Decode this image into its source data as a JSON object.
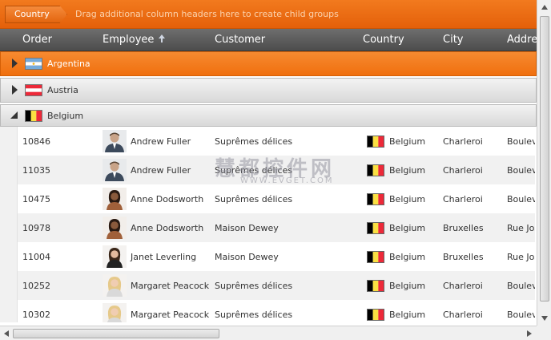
{
  "group_panel": {
    "chip_label": "Country",
    "hint": "Drag additional column headers here to create child groups"
  },
  "columns": [
    "Order",
    "Employee",
    "Customer",
    "Country",
    "City",
    "Addre"
  ],
  "groups": [
    {
      "label": "Argentina",
      "expanded": false,
      "active": true
    },
    {
      "label": "Austria",
      "expanded": false,
      "active": false
    },
    {
      "label": "Belgium",
      "expanded": true,
      "active": false
    }
  ],
  "rows": [
    {
      "order": "10846",
      "employee": "Andrew Fuller",
      "customer": "Suprêmes délices",
      "country": "Belgium",
      "city": "Charleroi",
      "address": "Boulev"
    },
    {
      "order": "11035",
      "employee": "Andrew Fuller",
      "customer": "Suprêmes délices",
      "country": "Belgium",
      "city": "Charleroi",
      "address": "Boulev"
    },
    {
      "order": "10475",
      "employee": "Anne Dodsworth",
      "customer": "Suprêmes délices",
      "country": "Belgium",
      "city": "Charleroi",
      "address": "Boulev"
    },
    {
      "order": "10978",
      "employee": "Anne Dodsworth",
      "customer": "Maison Dewey",
      "country": "Belgium",
      "city": "Bruxelles",
      "address": "Rue Jos"
    },
    {
      "order": "11004",
      "employee": "Janet Leverling",
      "customer": "Maison Dewey",
      "country": "Belgium",
      "city": "Bruxelles",
      "address": "Rue Jos"
    },
    {
      "order": "10252",
      "employee": "Margaret Peacock",
      "customer": "Suprêmes délices",
      "country": "Belgium",
      "city": "Charleroi",
      "address": "Boulev"
    },
    {
      "order": "10302",
      "employee": "Margaret Peacock",
      "customer": "Suprêmes délices",
      "country": "Belgium",
      "city": "Charleroi",
      "address": "Boulev"
    }
  ],
  "watermark": {
    "main": "慧都控件网",
    "sub": "WWW.EVGET.COM"
  },
  "colors": {
    "accent": "#f07010",
    "header": "#5a5a5a"
  }
}
